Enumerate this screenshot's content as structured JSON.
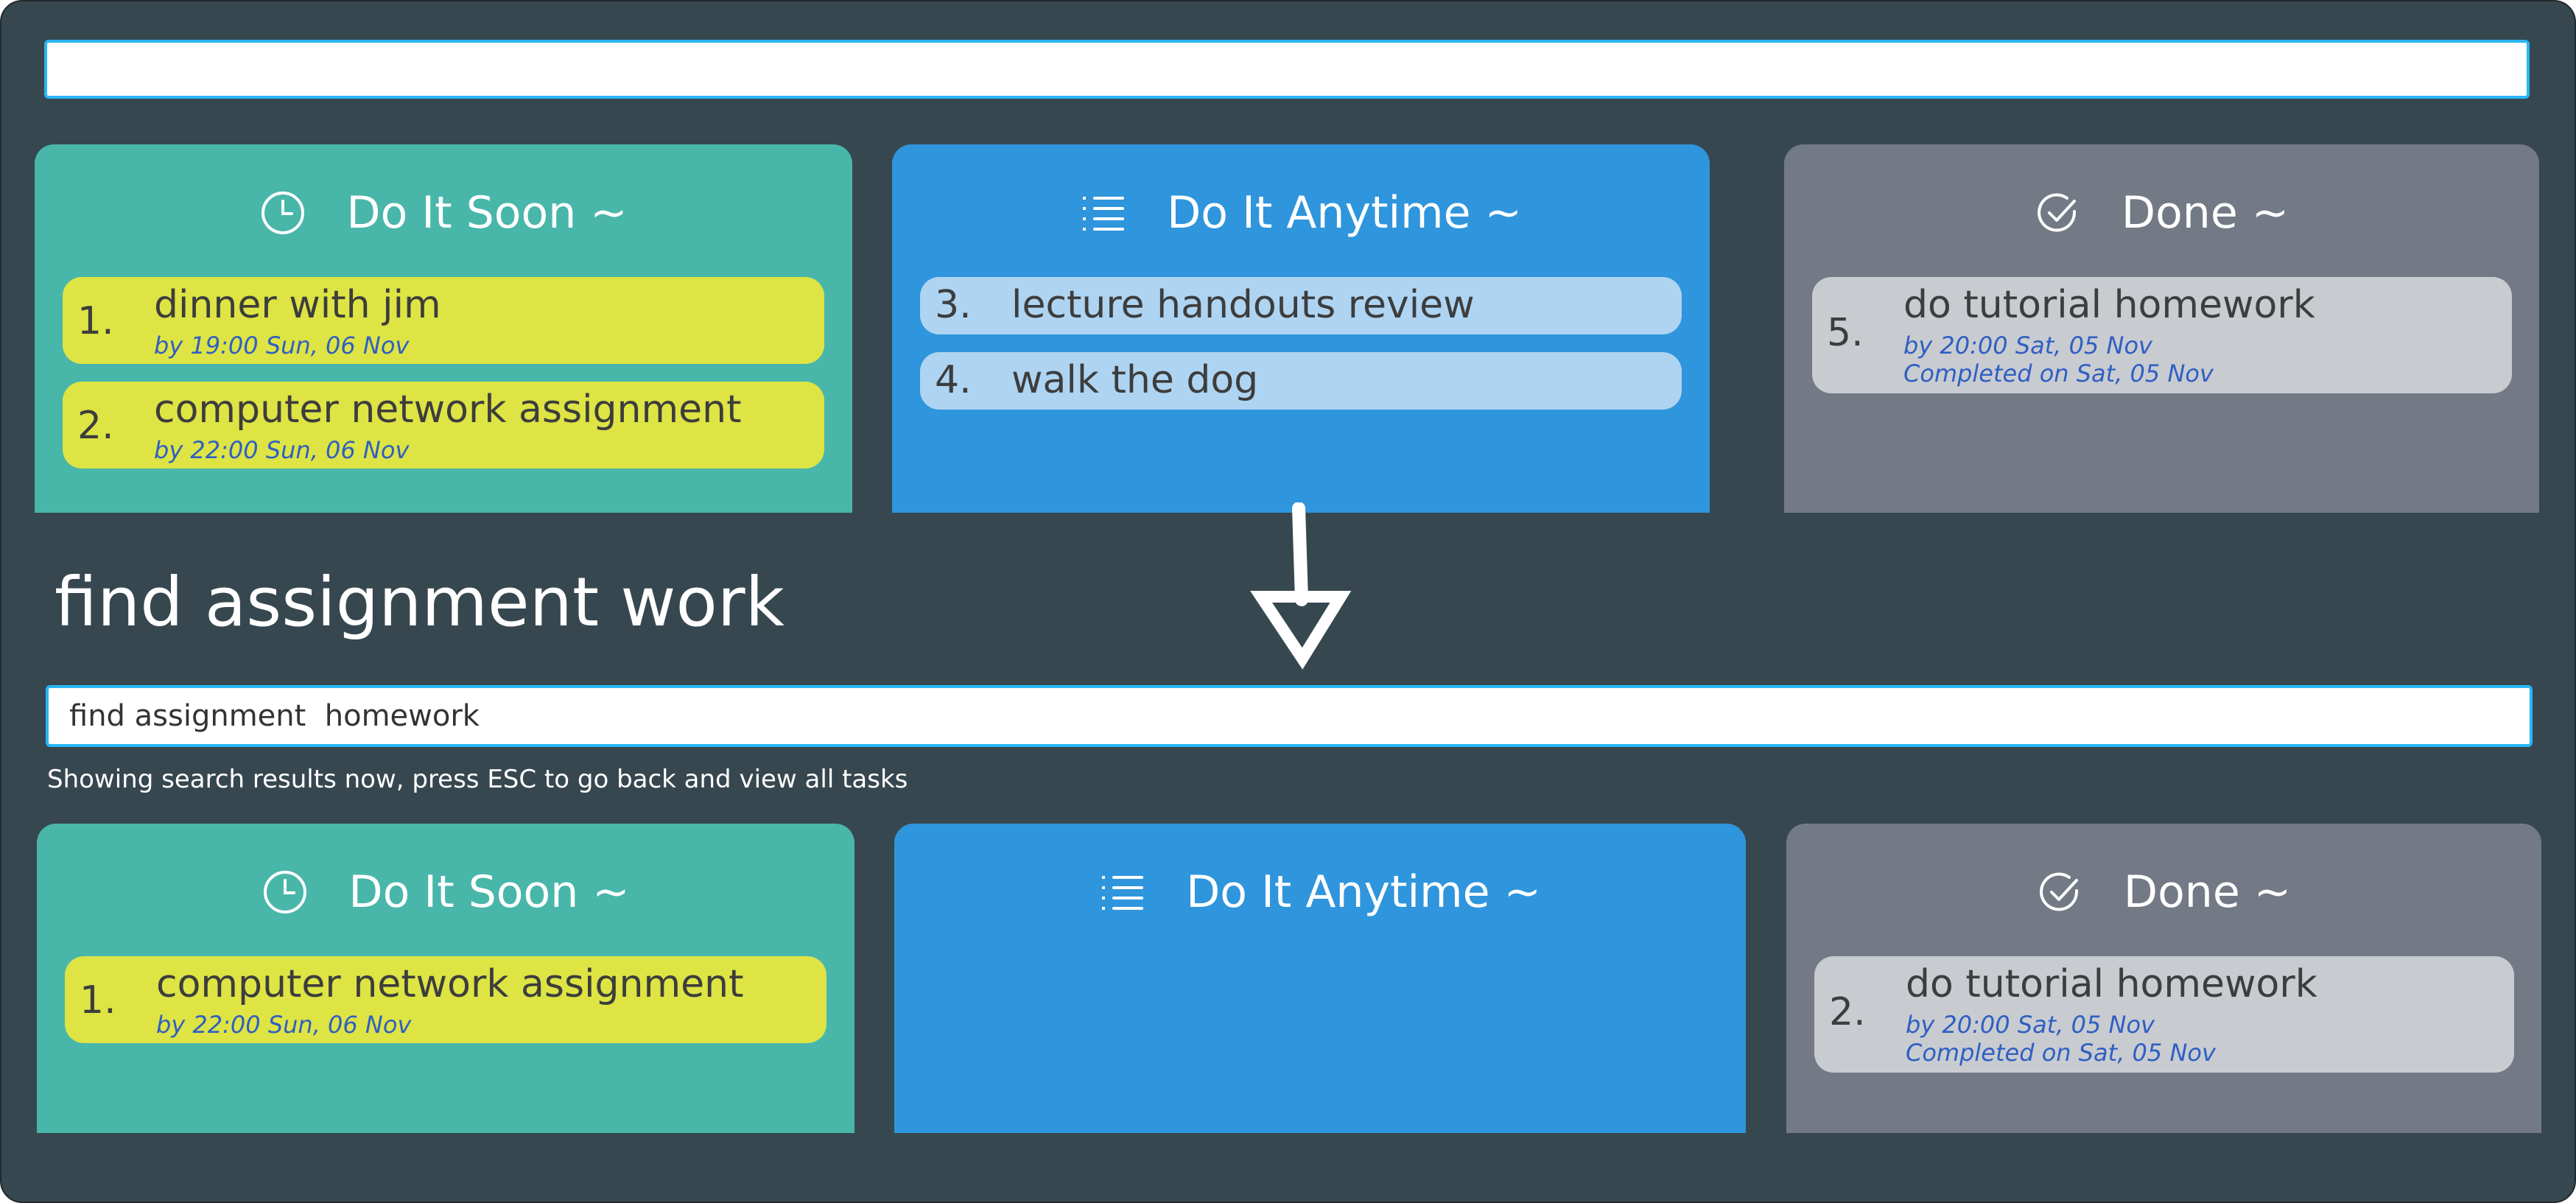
{
  "top": {
    "command_value": "",
    "columns": {
      "soon": {
        "title": "Do It Soon ~",
        "tasks": [
          {
            "index": "1.",
            "title": "dinner with jim",
            "deadline": "by 19:00 Sun, 06 Nov"
          },
          {
            "index": "2.",
            "title": "computer network assignment",
            "deadline": "by 22:00 Sun, 06 Nov"
          }
        ]
      },
      "anytime": {
        "title": "Do It Anytime ~",
        "tasks": [
          {
            "index": "3.",
            "title": "lecture handouts review"
          },
          {
            "index": "4.",
            "title": "walk the dog"
          }
        ]
      },
      "done": {
        "title": "Done ~",
        "tasks": [
          {
            "index": "5.",
            "title": "do tutorial homework",
            "deadline": "by 20:00 Sat, 05 Nov",
            "completed": "Completed on Sat, 05 Nov"
          }
        ]
      }
    }
  },
  "caption": "find assignment work",
  "bottom": {
    "command_value": "find assignment  homework",
    "result_message": "Showing search results now, press ESC to go back and view all tasks",
    "columns": {
      "soon": {
        "title": "Do It Soon ~",
        "tasks": [
          {
            "index": "1.",
            "title": "computer network assignment",
            "deadline": "by 22:00 Sun, 06 Nov"
          }
        ]
      },
      "anytime": {
        "title": "Do It Anytime ~",
        "tasks": []
      },
      "done": {
        "title": "Done ~",
        "tasks": [
          {
            "index": "2.",
            "title": "do tutorial homework",
            "deadline": "by 20:00 Sat, 05 Nov",
            "completed": "Completed on Sat, 05 Nov"
          }
        ]
      }
    }
  },
  "icons": {
    "soon": "clock-icon",
    "anytime": "list-icon",
    "done": "check-circle-icon",
    "arrow": "down-arrow-icon"
  },
  "colors": {
    "background": "#37474f",
    "soon": "#49b6aa",
    "anytime": "#2f95dc",
    "done": "#737985",
    "card_yellow": "#dde444",
    "card_light_blue": "#aed4f2",
    "card_grey": "#c8cbd0",
    "deadline_text": "#2f5fc2",
    "input_border": "#29b6f6"
  }
}
